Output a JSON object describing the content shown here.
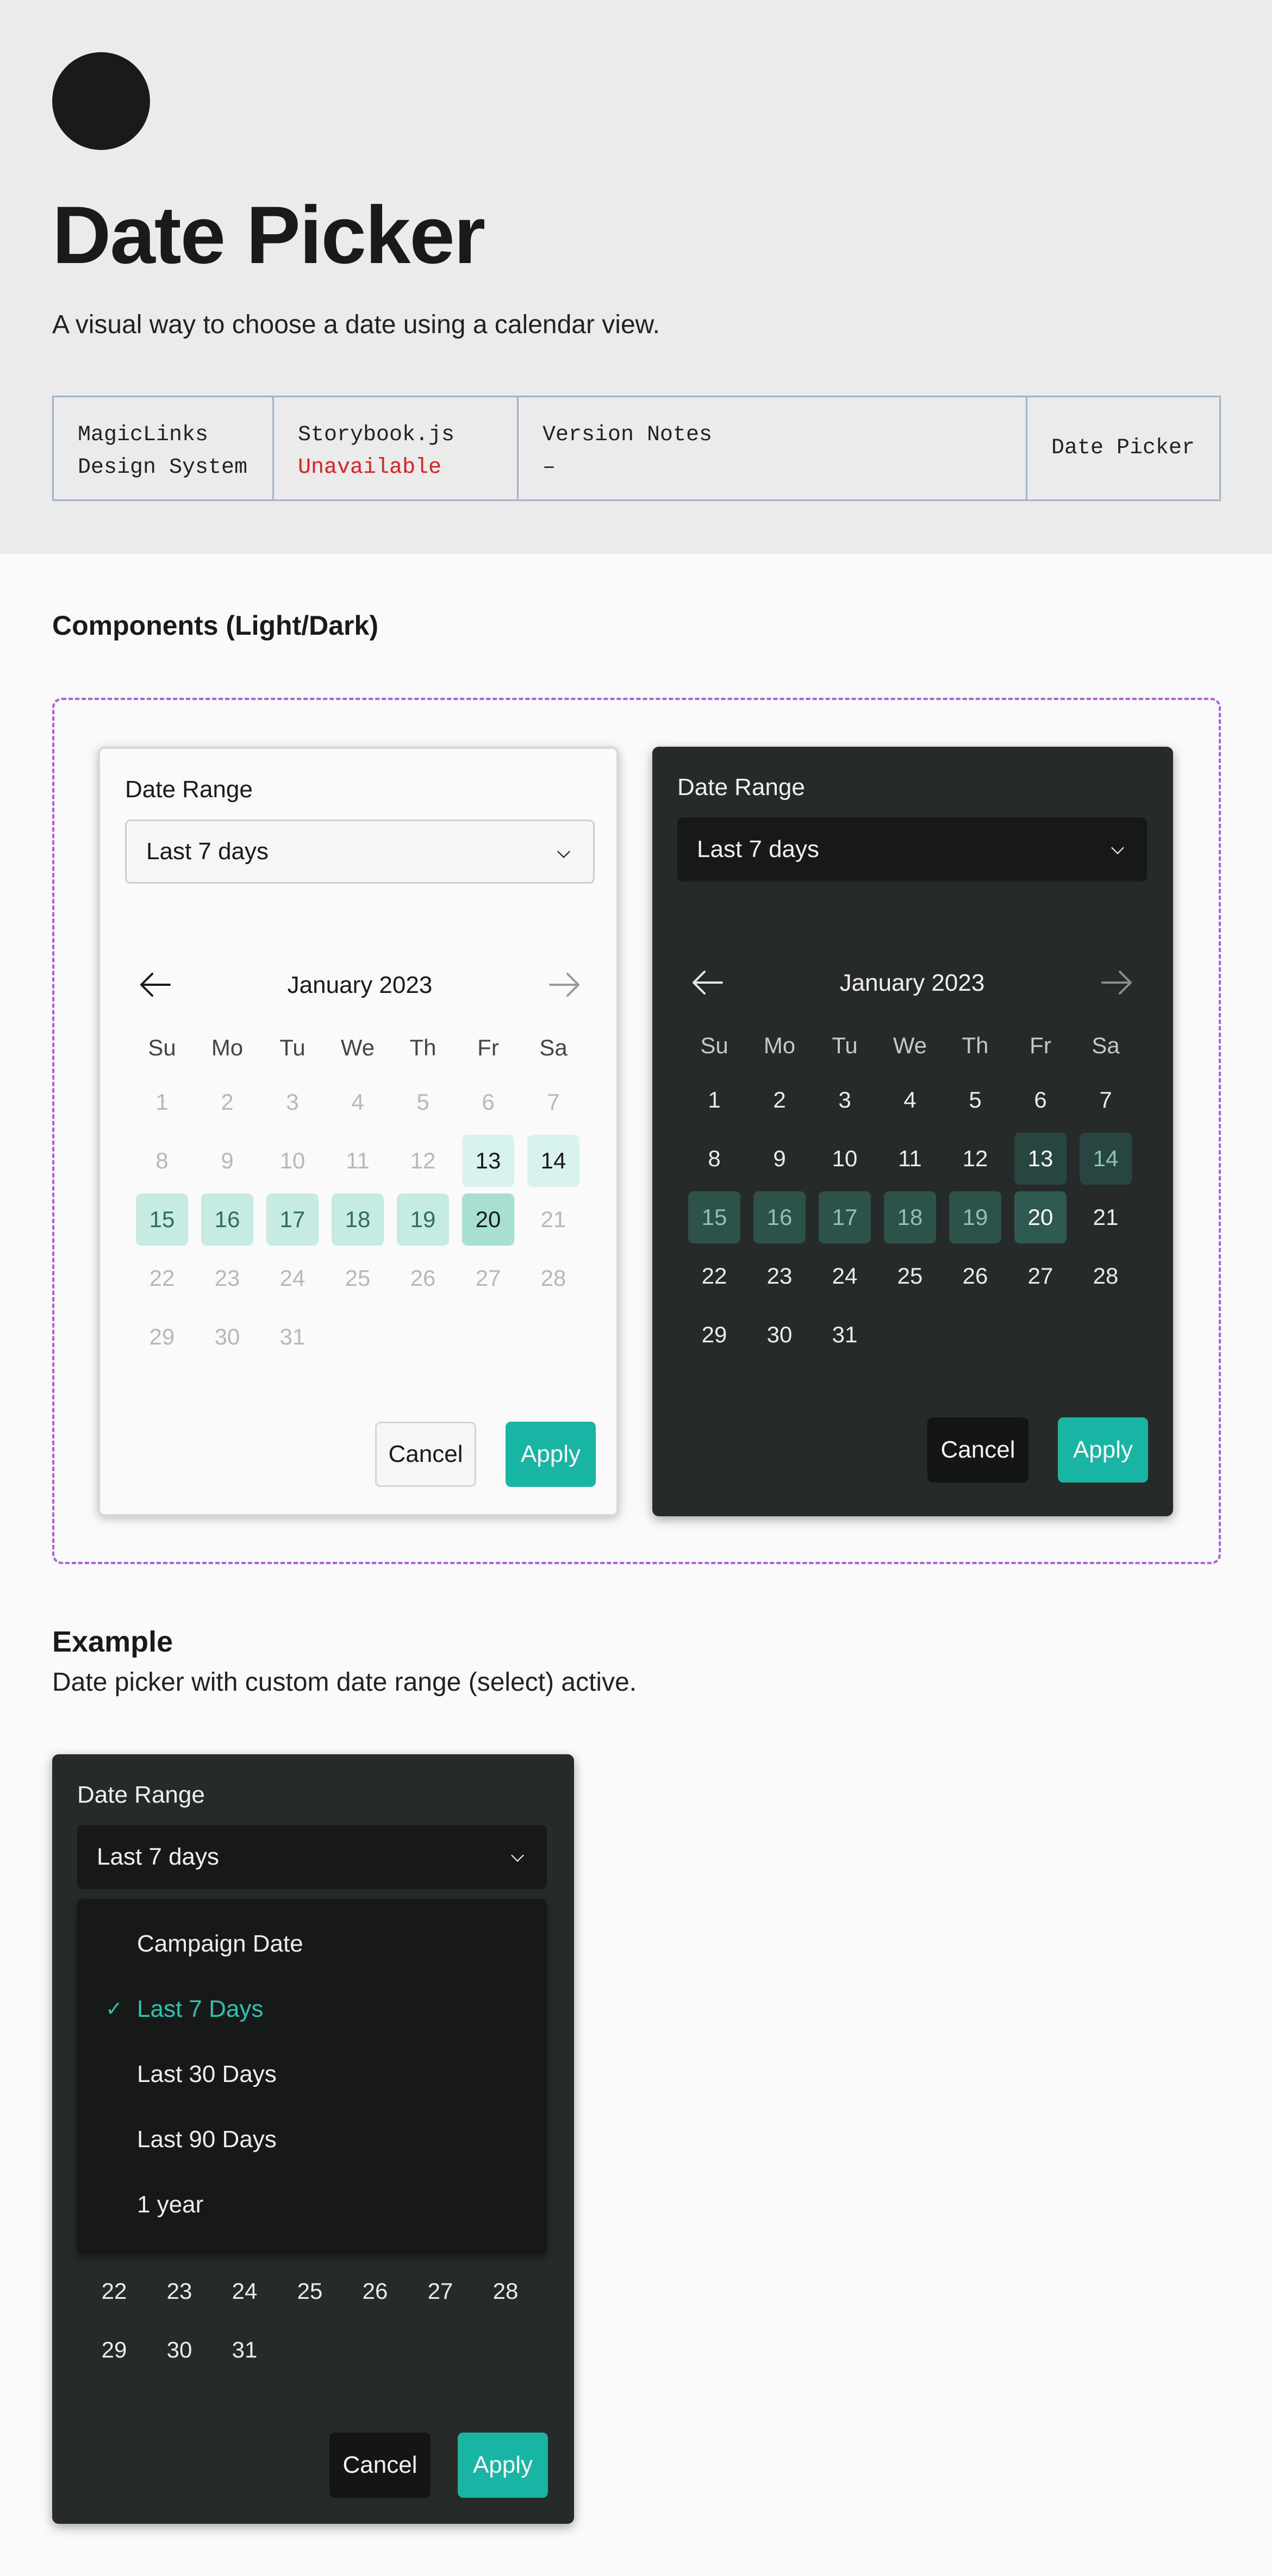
{
  "header": {
    "title": "Date Picker",
    "subtitle": "A visual way to choose a date using a calendar view.",
    "info": {
      "system_line1": "MagicLinks",
      "system_line2": "Design System",
      "storybook_label": "Storybook.js",
      "storybook_status": "Unavailable",
      "version_label": "Version Notes",
      "version_value": "–",
      "component_name": "Date Picker"
    }
  },
  "components_section": {
    "title": "Components (Light/Dark)"
  },
  "picker": {
    "label": "Date Range",
    "selected": "Last 7 days",
    "month": "January 2023",
    "weekdays": [
      "Su",
      "Mo",
      "Tu",
      "We",
      "Th",
      "Fr",
      "Sa"
    ],
    "days": [
      "1",
      "2",
      "3",
      "4",
      "5",
      "6",
      "7",
      "8",
      "9",
      "10",
      "11",
      "12",
      "13",
      "14",
      "15",
      "16",
      "17",
      "18",
      "19",
      "20",
      "21",
      "22",
      "23",
      "24",
      "25",
      "26",
      "27",
      "28",
      "29",
      "30",
      "31"
    ],
    "range_start": 13,
    "range_end": 20,
    "cancel": "Cancel",
    "apply": "Apply"
  },
  "example": {
    "title": "Example",
    "subtitle": "Date picker with custom date range (select) active.",
    "options": [
      "Campaign Date",
      "Last 7 Days",
      "Last 30 Days",
      "Last 90 Days",
      "1 year"
    ],
    "active_option": "Last 7 Days",
    "visible_days": [
      "22",
      "23",
      "24",
      "25",
      "26",
      "27",
      "28",
      "29",
      "30",
      "31"
    ]
  },
  "colors": {
    "accent": "#18b5a4",
    "dark_surface": "#262a28",
    "unavailable": "#e02020",
    "outline": "#b05ce8"
  },
  "icons": [
    "arrow-left-icon",
    "arrow-right-icon",
    "chevron-down-icon",
    "check-icon"
  ]
}
